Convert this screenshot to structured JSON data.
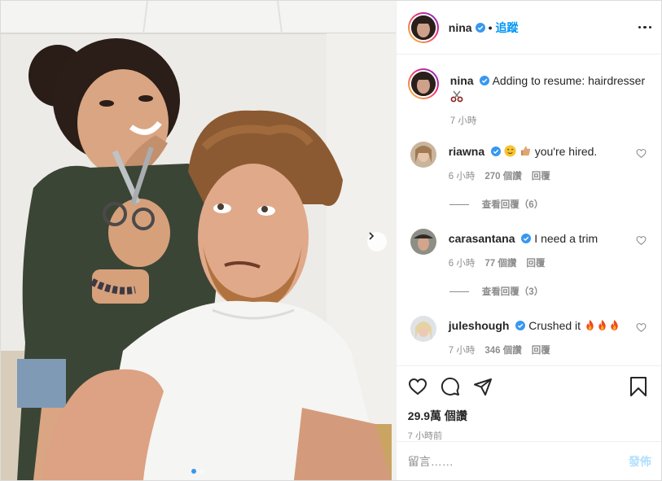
{
  "post": {
    "author": "nina",
    "follow_label": "追蹤",
    "separator": "•",
    "caption": "Adding to resume: hairdresser",
    "caption_time": "7 小時",
    "carousel": {
      "slide_count": 2,
      "current_slide": 1
    }
  },
  "comments": [
    {
      "user": "riawna",
      "text": "you're hired.",
      "time": "6 小時",
      "likes": "270 個讚",
      "reply_label": "回覆",
      "view_replies": "查看回覆（6）"
    },
    {
      "user": "carasantana",
      "text": "I need a trim",
      "time": "6 小時",
      "likes": "77 個讚",
      "reply_label": "回覆",
      "view_replies": "查看回覆（3）"
    },
    {
      "user": "juleshough",
      "text": "Crushed it",
      "time": "7 小時",
      "likes": "346 個讚",
      "reply_label": "回覆"
    }
  ],
  "stats": {
    "views": "29.9萬 個讚",
    "posted": "7 小時前"
  },
  "composer": {
    "placeholder": "留言……",
    "publish_label": "發佈"
  },
  "colors": {
    "accent": "#0095f6",
    "verified": "#3897f0",
    "publish_disabled": "#b2dffc",
    "muted": "#8e8e8e"
  },
  "icons": [
    "verified-badge",
    "more-icon",
    "heart-icon",
    "comment-icon",
    "share-icon",
    "bookmark-icon",
    "scissors-emoji",
    "wink-emoji",
    "thumbs-up-emoji",
    "fire-emoji",
    "chevron-right-icon"
  ]
}
